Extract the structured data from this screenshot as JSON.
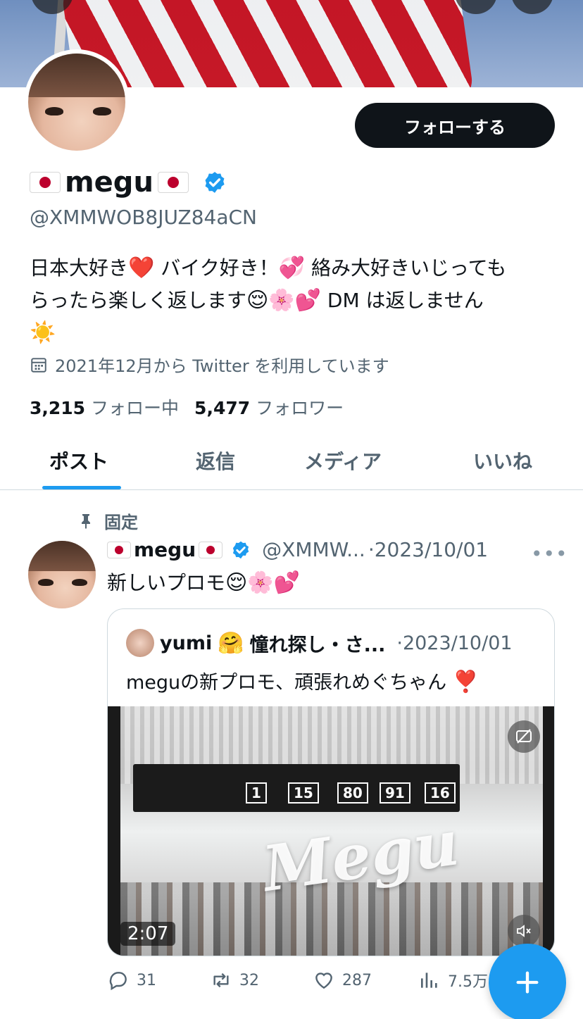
{
  "profile": {
    "follow_label": "フォローする",
    "name": "megu",
    "handle": "@XMMWOB8JUZ84aCN",
    "bio_line1_a": "日本大好き",
    "bio_line1_b": "バイク好き！",
    "bio_line1_c": "絡み大好きいじっても",
    "bio_line2_a": "らったら楽しく返します",
    "bio_line2_b": "DM は返しません",
    "joined": "2021年12月から Twitter を利用しています",
    "following_count": "3,215",
    "following_label": "フォロー中",
    "followers_count": "5,477",
    "followers_label": "フォロワー"
  },
  "tabs": [
    {
      "label": "ポスト",
      "active": true
    },
    {
      "label": "返信",
      "active": false
    },
    {
      "label": "メディア",
      "active": false
    },
    {
      "label": "いいね",
      "active": false
    }
  ],
  "pinned": {
    "label": "固定",
    "author": "megu",
    "handle": "@XMMW...",
    "date": "·2023/10/01",
    "text": "新しいプロモ",
    "quote": {
      "author": "yumi",
      "display_suffix": "憧れ探し・さ...",
      "date": "·2023/10/01",
      "text": "meguの新プロモ、頑張れめぐちゃん",
      "video": {
        "watermark": "Megu",
        "duration": "2:07",
        "sign_left": "1",
        "sign_left_2": "15",
        "sign_mid": "80",
        "sign_mid_2": "91",
        "sign_right": "16"
      }
    },
    "replies": "31",
    "reposts": "32",
    "likes": "287",
    "views": "7.5万"
  },
  "colors": {
    "accent": "#1d9bf0",
    "text": "#0f1419",
    "secondary": "#536471"
  },
  "icons": [
    "calendar-icon",
    "pin-icon",
    "verified-badge-icon",
    "more-icon",
    "reply-icon",
    "repost-icon",
    "like-icon",
    "views-icon",
    "compose-icon",
    "captions-icon",
    "mute-icon"
  ]
}
